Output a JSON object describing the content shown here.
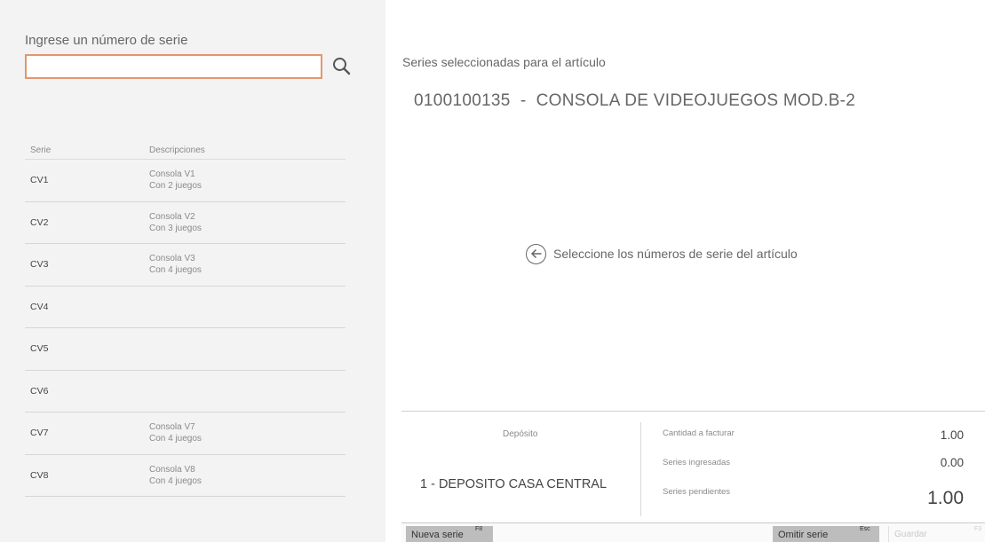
{
  "search": {
    "label": "Ingrese un número de serie",
    "value": "",
    "placeholder": ""
  },
  "grid": {
    "headers": {
      "serie": "Serie",
      "descripciones": "Descripciones"
    },
    "rows": [
      {
        "serie": "CV1",
        "desc1": "Consola V1",
        "desc2": "Con 2 juegos"
      },
      {
        "serie": "CV2",
        "desc1": "Consola V2",
        "desc2": "Con 3 juegos"
      },
      {
        "serie": "CV3",
        "desc1": "Consola V3",
        "desc2": "Con 4 juegos"
      },
      {
        "serie": "CV4",
        "desc1": "",
        "desc2": ""
      },
      {
        "serie": "CV5",
        "desc1": "",
        "desc2": ""
      },
      {
        "serie": "CV6",
        "desc1": "",
        "desc2": ""
      },
      {
        "serie": "CV7",
        "desc1": "Consola V7",
        "desc2": "Con 4 juegos"
      },
      {
        "serie": "CV8",
        "desc1": "Consola V8",
        "desc2": "Con 4 juegos"
      }
    ]
  },
  "main": {
    "title": "Series seleccionadas para el artículo",
    "article_code": "0100100135",
    "article_separator": "-",
    "article_name": "CONSOLA DE VIDEOJUEGOS MOD.B-2",
    "hint": "Seleccione los números de serie del artículo",
    "hint_icon": "arrow-left-circle-icon"
  },
  "footer": {
    "deposito_label": "Depósito",
    "deposito_value": "1 - DEPOSITO CASA CENTRAL",
    "cantidad_label": "Cantidad a facturar",
    "cantidad_value": "1.00",
    "ingresadas_label": "Series ingresadas",
    "ingresadas_value": "0.00",
    "pendientes_label": "Series pendientes",
    "pendientes_value": "1.00"
  },
  "actions": {
    "nueva_label": "Nueva serie",
    "nueva_key": "F8",
    "omitir_label": "Omitir serie",
    "omitir_key": "Esc",
    "guardar_label": "Guardar",
    "guardar_key": "F3"
  },
  "colors": {
    "left_panel_bg": "#f3f3f3",
    "search_border": "#e39670",
    "button_bg": "#bdbdbd"
  }
}
